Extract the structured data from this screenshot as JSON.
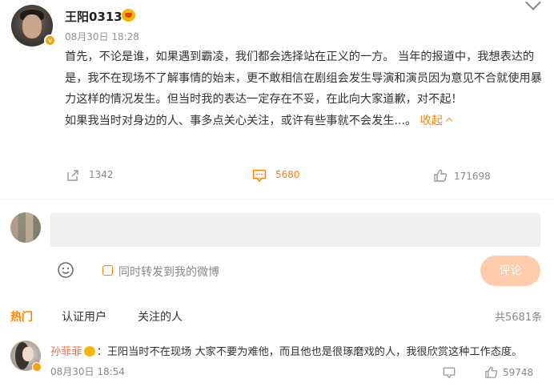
{
  "post": {
    "username": "王阳0313",
    "time": "08月30日 18:28",
    "paragraph1": "首先，不论是谁，如果遇到霸凌，我们都会选择站在正义的一方。 当年的报道中，我想表达的是，我不在现场不了解事情的始末，更不敢相信在剧组会发生导演和演员因为意见不合就使用暴力这样的情况发生。但当时我的表达一定存在不妥，在此向大家道歉，对不起！",
    "paragraph2": "如果我当时对身边的人、事多点关心关注，或许有些事就不会发生...。",
    "collapse_label": "收起",
    "reposts": "1342",
    "comments": "5680",
    "likes": "171698"
  },
  "composer": {
    "repost_label": "同时转发到我的微博",
    "submit_label": "评论"
  },
  "tabs": [
    {
      "label": "热门"
    },
    {
      "label": "认证用户"
    },
    {
      "label": "关注的人"
    }
  ],
  "total_comments": "共5681条",
  "comment": {
    "user": "孙菲菲",
    "text": "：王阳当时不在现场 大家不要为难他，而且他也是很琢磨戏的人，我很欣赏这种工作态度。",
    "time": "08月30日 18:54",
    "likes": "59748"
  },
  "colors": {
    "accent": "#ff8200",
    "comment_user": "#eb7350",
    "submit_disabled": "#ffcbaa"
  },
  "icons": [
    "repost-icon",
    "comment-icon",
    "like-icon",
    "emoji-icon",
    "reply-icon",
    "verified-icon",
    "vip-icon",
    "chevron-down-icon"
  ]
}
